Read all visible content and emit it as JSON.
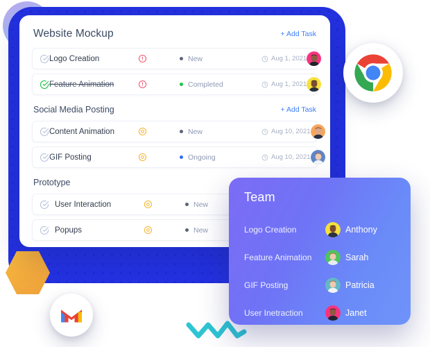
{
  "task_card": {
    "title": "Website Mockup",
    "add_task_label": "+ Add Task",
    "sections": [
      {
        "title": "Website Mockup",
        "is_card_header": true,
        "add_task_label": "+ Add Task",
        "rows": [
          {
            "check_icon": "check-circle-icon",
            "completed": false,
            "name": "Logo Creation",
            "priority_icon": "alert-circle-icon",
            "priority_color": "#f4526b",
            "status": "New",
            "status_color": "#5b6478",
            "date_icon": "clock-icon",
            "date": "Aug 1, 2021",
            "avatar": "avatar-anthony"
          },
          {
            "check_icon": "check-circle-icon",
            "completed": true,
            "name": "Feature Animation",
            "priority_icon": "alert-circle-icon",
            "priority_color": "#f4526b",
            "status": "Completed",
            "status_color": "#1fc44a",
            "date_icon": "clock-icon",
            "date": "Aug 1, 2021",
            "avatar": "avatar-sarah-y"
          }
        ]
      },
      {
        "title": "Social Media Posting",
        "is_card_header": false,
        "add_task_label": "+ Add Task",
        "rows": [
          {
            "check_icon": "check-circle-icon",
            "completed": false,
            "name": "Content Animation",
            "priority_icon": "target-circle-icon",
            "priority_color": "#f5b328",
            "status": "New",
            "status_color": "#5b6478",
            "date_icon": "clock-icon",
            "date": "Aug 10, 2021",
            "avatar": "avatar-orange"
          },
          {
            "check_icon": "check-circle-icon",
            "completed": false,
            "name": "GIF Posting",
            "priority_icon": "target-circle-icon",
            "priority_color": "#f5b328",
            "status": "Ongoing",
            "status_color": "#2f6df6",
            "date_icon": "clock-icon",
            "date": "Aug 10, 2021",
            "avatar": "avatar-patricia"
          }
        ]
      },
      {
        "title": "Prototype",
        "is_card_header": false,
        "add_task_label": "",
        "rows": [
          {
            "check_icon": "check-circle-icon",
            "completed": false,
            "name": "User Interaction",
            "priority_icon": "target-circle-icon",
            "priority_color": "#f5b328",
            "status": "New",
            "status_color": "#5b6478",
            "date_icon": "",
            "date": "",
            "avatar": ""
          },
          {
            "check_icon": "check-circle-icon",
            "completed": false,
            "name": "Popups",
            "priority_icon": "target-circle-icon",
            "priority_color": "#f5b328",
            "status": "New",
            "status_color": "#5b6478",
            "date_icon": "",
            "date": "",
            "avatar": ""
          }
        ]
      }
    ]
  },
  "team_card": {
    "title": "Team",
    "members": [
      {
        "task": "Logo Creation",
        "name": "Anthony",
        "avatar": "avatar-anthony-yellow"
      },
      {
        "task": "Feature Animation",
        "name": "Sarah",
        "avatar": "avatar-sarah-green"
      },
      {
        "task": "GIF Posting",
        "name": "Patricia",
        "avatar": "avatar-patricia-teal"
      },
      {
        "task": "User Inetraction",
        "name": "Janet",
        "avatar": "avatar-janet-pink"
      }
    ]
  },
  "decorations": {
    "chrome_icon": "chrome-logo-icon",
    "gmail_icon": "gmail-logo-icon",
    "hexagon": "orange-hexagon-shape",
    "squiggle": "cyan-zigzag-shape",
    "gradient_circle": "purple-cyan-circle-shape",
    "blue_panel_color": "#2331e0"
  }
}
